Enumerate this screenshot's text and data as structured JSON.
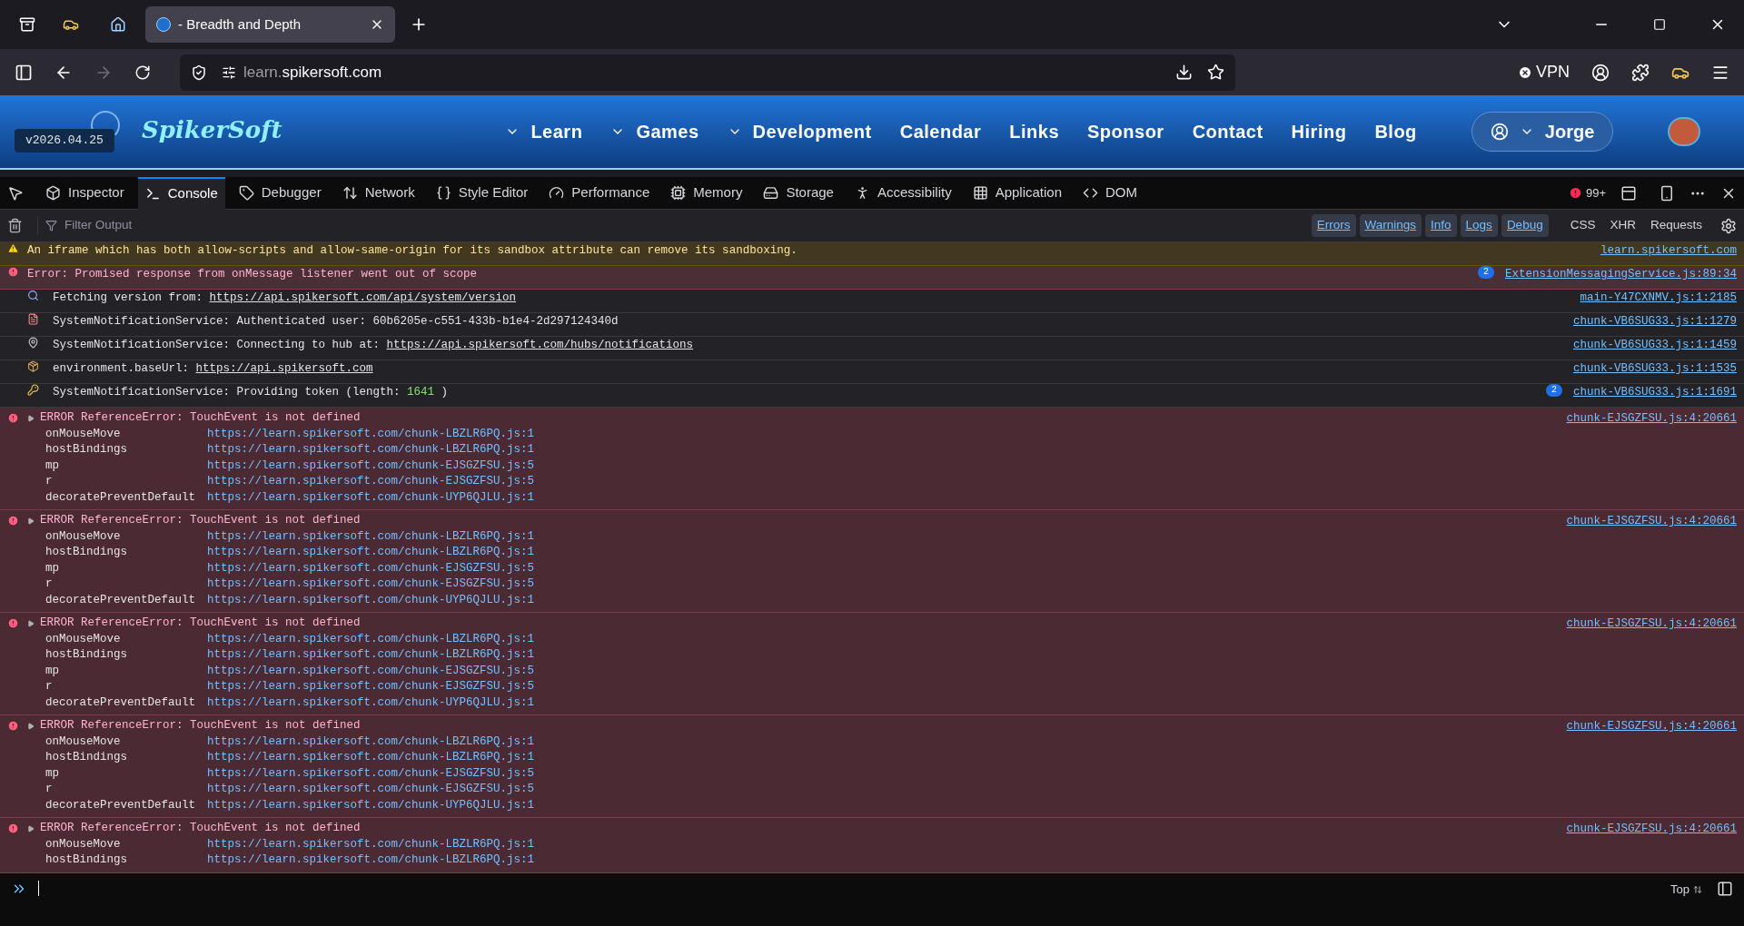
{
  "browser": {
    "tabs": [
      {
        "kind": "pinned",
        "selected": false
      },
      {
        "kind": "pinned",
        "selected": false
      },
      {
        "kind": "page",
        "title": "- Breadth and Depth",
        "selected": true
      }
    ],
    "address": {
      "host_prefix": "learn.",
      "domain": "spikersoft.com"
    },
    "vpn": "VPN"
  },
  "site": {
    "logo": "SpikerSoft",
    "version": "v2026.04.25",
    "nav": [
      {
        "kind": "dropdown",
        "label": "Learn"
      },
      {
        "kind": "dropdown",
        "label": "Games"
      },
      {
        "kind": "dropdown",
        "label": "Development"
      },
      {
        "kind": "link",
        "label": "Calendar"
      },
      {
        "kind": "link",
        "label": "Links"
      },
      {
        "kind": "link",
        "label": "Sponsor"
      },
      {
        "kind": "link",
        "label": "Contact"
      },
      {
        "kind": "link",
        "label": "Hiring"
      },
      {
        "kind": "link",
        "label": "Blog"
      }
    ],
    "user": "Jorge"
  },
  "devtools": {
    "tabs": [
      {
        "label": "Inspector",
        "selected": false
      },
      {
        "label": "Console",
        "selected": true
      },
      {
        "label": "Debugger",
        "selected": false
      },
      {
        "label": "Network",
        "selected": false
      },
      {
        "label": "Style Editor",
        "selected": false
      },
      {
        "label": "Performance",
        "selected": false
      },
      {
        "label": "Memory",
        "selected": false
      },
      {
        "label": "Storage",
        "selected": false
      },
      {
        "label": "Accessibility",
        "selected": false
      },
      {
        "label": "Application",
        "selected": false
      },
      {
        "label": "DOM",
        "selected": false
      }
    ],
    "error_count": "99+",
    "filter": {
      "placeholder": "Filter Output"
    },
    "filters": [
      {
        "label": "Errors",
        "selected": true
      },
      {
        "label": "Warnings",
        "selected": true
      },
      {
        "label": "Info",
        "selected": true
      },
      {
        "label": "Logs",
        "selected": true
      },
      {
        "label": "Debug",
        "selected": true
      },
      {
        "label": "CSS",
        "selected": false
      },
      {
        "label": "XHR",
        "selected": false
      },
      {
        "label": "Requests",
        "selected": false
      }
    ],
    "messages": [
      {
        "kind": "warning",
        "parts": [
          {
            "kind": "text",
            "text": "An iframe which has both allow-scripts and allow-same-origin for its sandbox attribute can remove its sandboxing."
          }
        ],
        "source": "learn.spikersoft.com"
      },
      {
        "kind": "error",
        "parts": [
          {
            "kind": "text",
            "text": "Error: Promised response from onMessage listener went out of scope"
          }
        ],
        "count": "2",
        "source": "ExtensionMessagingService.js:89:34"
      },
      {
        "kind": "log",
        "parts": [
          {
            "kind": "text",
            "text": "Fetching version from: "
          },
          {
            "kind": "link",
            "text": "https://api.spikersoft.com/api/system/version"
          }
        ],
        "source": "main-Y47CXNMV.js:1:2185"
      },
      {
        "kind": "log",
        "parts": [
          {
            "kind": "text",
            "text": "SystemNotificationService: Authenticated user: 60b6205e-c551-433b-b1e4-2d297124340d"
          }
        ],
        "source": "chunk-VB6SUG33.js:1:1279"
      },
      {
        "kind": "log",
        "parts": [
          {
            "kind": "text",
            "text": "SystemNotificationService: Connecting to hub at: "
          },
          {
            "kind": "link",
            "text": "https://api.spikersoft.com/hubs/notifications"
          }
        ],
        "source": "chunk-VB6SUG33.js:1:1459"
      },
      {
        "kind": "log",
        "parts": [
          {
            "kind": "text",
            "text": "environment.baseUrl: "
          },
          {
            "kind": "link",
            "text": "https://api.spikersoft.com"
          }
        ],
        "source": "chunk-VB6SUG33.js:1:1535"
      },
      {
        "kind": "log",
        "parts": [
          {
            "kind": "text",
            "text": "SystemNotificationService: Providing token (length: "
          },
          {
            "kind": "number",
            "text": "1641"
          },
          {
            "kind": "text",
            "text": " )"
          }
        ],
        "count": "2",
        "source": "chunk-VB6SUG33.js:1:1691"
      },
      {
        "kind": "trace",
        "message": "ERROR ReferenceError: TouchEvent is not defined",
        "source": "chunk-EJSGZFSU.js:4:20661",
        "frames": [
          {
            "fn": "onMouseMove",
            "url": "https://learn.spikersoft.com/chunk-LBZLR6PQ.js:1"
          },
          {
            "fn": "hostBindings",
            "url": "https://learn.spikersoft.com/chunk-LBZLR6PQ.js:1"
          },
          {
            "fn": "mp",
            "url": "https://learn.spikersoft.com/chunk-EJSGZFSU.js:5"
          },
          {
            "fn": "r",
            "url": "https://learn.spikersoft.com/chunk-EJSGZFSU.js:5"
          },
          {
            "fn": "decoratePreventDefault",
            "url": "https://learn.spikersoft.com/chunk-UYP6QJLU.js:1"
          }
        ]
      },
      {
        "kind": "trace",
        "message": "ERROR ReferenceError: TouchEvent is not defined",
        "source": "chunk-EJSGZFSU.js:4:20661",
        "frames": [
          {
            "fn": "onMouseMove",
            "url": "https://learn.spikersoft.com/chunk-LBZLR6PQ.js:1"
          },
          {
            "fn": "hostBindings",
            "url": "https://learn.spikersoft.com/chunk-LBZLR6PQ.js:1"
          },
          {
            "fn": "mp",
            "url": "https://learn.spikersoft.com/chunk-EJSGZFSU.js:5"
          },
          {
            "fn": "r",
            "url": "https://learn.spikersoft.com/chunk-EJSGZFSU.js:5"
          },
          {
            "fn": "decoratePreventDefault",
            "url": "https://learn.spikersoft.com/chunk-UYP6QJLU.js:1"
          }
        ]
      },
      {
        "kind": "trace",
        "message": "ERROR ReferenceError: TouchEvent is not defined",
        "source": "chunk-EJSGZFSU.js:4:20661",
        "frames": [
          {
            "fn": "onMouseMove",
            "url": "https://learn.spikersoft.com/chunk-LBZLR6PQ.js:1"
          },
          {
            "fn": "hostBindings",
            "url": "https://learn.spikersoft.com/chunk-LBZLR6PQ.js:1"
          },
          {
            "fn": "mp",
            "url": "https://learn.spikersoft.com/chunk-EJSGZFSU.js:5"
          },
          {
            "fn": "r",
            "url": "https://learn.spikersoft.com/chunk-EJSGZFSU.js:5"
          },
          {
            "fn": "decoratePreventDefault",
            "url": "https://learn.spikersoft.com/chunk-UYP6QJLU.js:1"
          }
        ]
      },
      {
        "kind": "trace",
        "message": "ERROR ReferenceError: TouchEvent is not defined",
        "source": "chunk-EJSGZFSU.js:4:20661",
        "frames": [
          {
            "fn": "onMouseMove",
            "url": "https://learn.spikersoft.com/chunk-LBZLR6PQ.js:1"
          },
          {
            "fn": "hostBindings",
            "url": "https://learn.spikersoft.com/chunk-LBZLR6PQ.js:1"
          },
          {
            "fn": "mp",
            "url": "https://learn.spikersoft.com/chunk-EJSGZFSU.js:5"
          },
          {
            "fn": "r",
            "url": "https://learn.spikersoft.com/chunk-EJSGZFSU.js:5"
          },
          {
            "fn": "decoratePreventDefault",
            "url": "https://learn.spikersoft.com/chunk-UYP6QJLU.js:1"
          }
        ]
      },
      {
        "kind": "trace",
        "message": "ERROR ReferenceError: TouchEvent is not defined",
        "source": "chunk-EJSGZFSU.js:4:20661",
        "frames": [
          {
            "fn": "onMouseMove",
            "url": "https://learn.spikersoft.com/chunk-LBZLR6PQ.js:1"
          },
          {
            "fn": "hostBindings",
            "url": "https://learn.spikersoft.com/chunk-LBZLR6PQ.js:1"
          }
        ]
      }
    ],
    "context": "Top"
  }
}
